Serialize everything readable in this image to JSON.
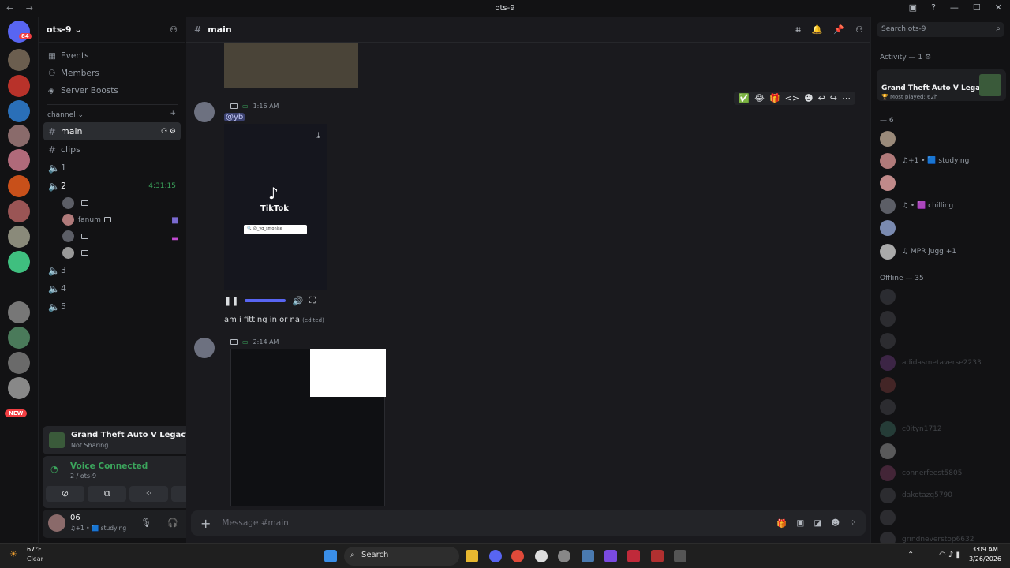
{
  "window": {
    "title": "ots-9",
    "nav": "← →"
  },
  "server": {
    "name": "ots-9 ⌄",
    "mention_badge": "84",
    "new_badge": "NEW"
  },
  "sidebar": {
    "nav": [
      {
        "icon": "calendar-icon",
        "label": "Events"
      },
      {
        "icon": "members-icon",
        "label": "Members"
      },
      {
        "icon": "boost-icon",
        "label": "Server Boosts"
      }
    ],
    "category": "channel ⌄",
    "channels": [
      {
        "type": "text",
        "name": "main",
        "selected": true
      },
      {
        "type": "text",
        "name": "clips"
      },
      {
        "type": "voice",
        "name": "1"
      },
      {
        "type": "voice",
        "name": "2",
        "timer": "4:31:15"
      },
      {
        "type": "voice",
        "name": "3"
      },
      {
        "type": "voice",
        "name": "4"
      },
      {
        "type": "voice",
        "name": "5"
      }
    ],
    "voice_users": [
      {
        "name": ""
      },
      {
        "name": "fanum"
      },
      {
        "name": ""
      },
      {
        "name": ""
      }
    ]
  },
  "activity_panel": {
    "game": "Grand Theft Auto V Legacy",
    "status": "Not Sharing"
  },
  "voice_panel": {
    "status": "Voice Connected",
    "channel": "2 / ots-9"
  },
  "user_panel": {
    "name": "06",
    "status": "♫+1 • 🟦 studying"
  },
  "channel": {
    "name": "main"
  },
  "messages": [
    {
      "time": "1:16 AM",
      "mention": "@yb",
      "video": {
        "brand": "TikTok",
        "search": "🔍 @_yg_smonise"
      },
      "text": "am i fitting in or na",
      "edited": "(edited)"
    },
    {
      "time": "2:14 AM"
    }
  ],
  "reactions": [
    "✅",
    "😂",
    "🎁",
    "<>",
    "☻",
    "↩",
    "↪",
    "⋯"
  ],
  "composer": {
    "placeholder": "Message #main"
  },
  "members": {
    "search_placeholder": "Search ots-9",
    "activity_header": "Activity — 1 ⚙",
    "activity_card": {
      "game": "Grand Theft Auto V Legacy",
      "detail": "🏆 Most played: 62h"
    },
    "online_header": "— 6",
    "online": [
      {
        "status": ""
      },
      {
        "status": "♫+1 • 🟦 studying"
      },
      {
        "status": ""
      },
      {
        "status": "♫ • 🟪 chilling"
      },
      {
        "status": ""
      },
      {
        "status": "♫ MPR jugg +1"
      }
    ],
    "offline_header": "Offline — 35",
    "offline": [
      {
        "name": ""
      },
      {
        "name": ""
      },
      {
        "name": ""
      },
      {
        "name": "adidasmetaverse2233"
      },
      {
        "name": ""
      },
      {
        "name": ""
      },
      {
        "name": "c0ityn1712"
      },
      {
        "name": ""
      },
      {
        "name": "connerfeest5805"
      },
      {
        "name": "dakotazq5790"
      },
      {
        "name": ""
      },
      {
        "name": "grindneverstop6632"
      }
    ]
  },
  "taskbar": {
    "weather_temp": "67°F",
    "weather_desc": "Clear",
    "search": "Search",
    "time": "3:09 AM",
    "date": "3/26/2026"
  }
}
